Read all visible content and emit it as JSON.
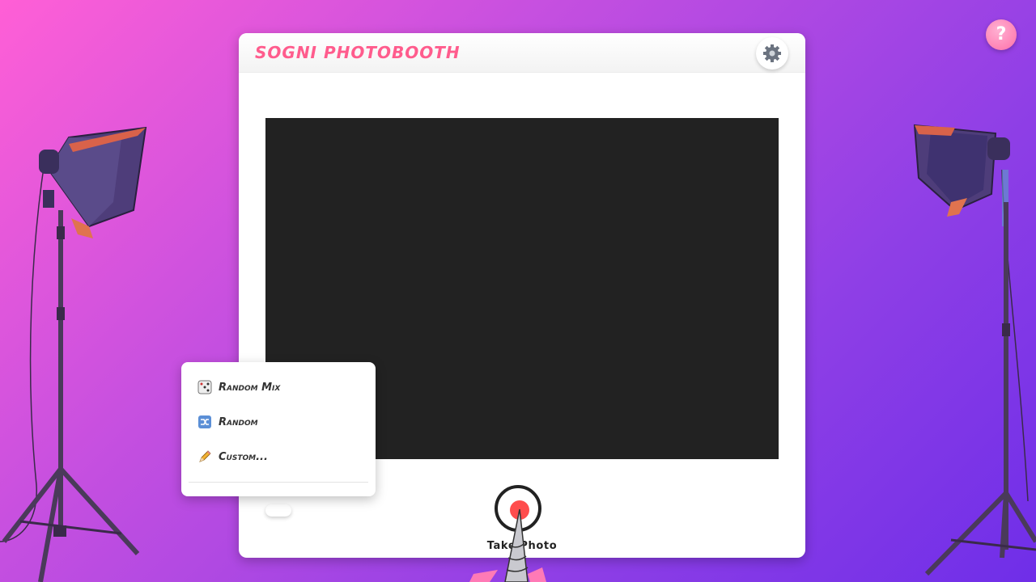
{
  "app": {
    "title": "SOGNI PHOTOBOOTH"
  },
  "help": {
    "label": "?"
  },
  "header": {
    "settings_icon": "gear-icon"
  },
  "camera": {
    "state": "blank"
  },
  "capture": {
    "button_icon": "record-icon",
    "label": "Take Photo"
  },
  "style_menu": {
    "items": [
      {
        "icon": "dice-icon",
        "label": "Random Mix"
      },
      {
        "icon": "shuffle-icon",
        "label": "Random"
      },
      {
        "icon": "pencil-icon",
        "label": "Custom..."
      }
    ]
  },
  "colors": {
    "background_start": "#ff5fd6",
    "background_end": "#6f2ee8",
    "title": "#ff5c8d",
    "record": "#ff4d4d",
    "camera_view": "#222222"
  }
}
